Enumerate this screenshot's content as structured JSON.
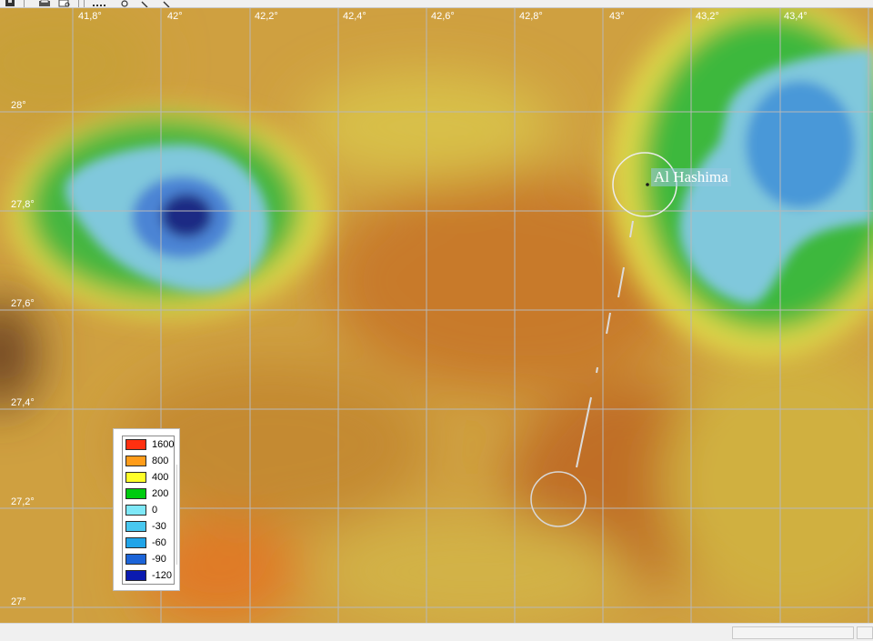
{
  "toolbar": {
    "buttons": [
      {
        "name": "save-icon"
      },
      {
        "name": "print-icon"
      },
      {
        "name": "print-preview-icon"
      },
      {
        "name": "grid-icon"
      },
      {
        "name": "settings-icon"
      },
      {
        "name": "zoom-icon"
      },
      {
        "name": "search-icon"
      }
    ]
  },
  "map": {
    "longitude_labels": [
      "41,8°",
      "42°",
      "42,2°",
      "42,4°",
      "42,6°",
      "42,8°",
      "43°",
      "43,2°",
      "43,4°"
    ],
    "latitude_labels": [
      "28°",
      "27,8°",
      "27,6°",
      "27,4°",
      "27,2°",
      "27°"
    ],
    "place": {
      "name": "Al Hashima"
    }
  },
  "legend": {
    "entries": [
      {
        "value": "1600",
        "color": "#ff3010"
      },
      {
        "value": "800",
        "color": "#ff9c1a"
      },
      {
        "value": "400",
        "color": "#ffff28"
      },
      {
        "value": "200",
        "color": "#00cc10"
      },
      {
        "value": "0",
        "color": "#7ee8f8"
      },
      {
        "value": "-30",
        "color": "#48c8f0"
      },
      {
        "value": "-60",
        "color": "#20a4e8"
      },
      {
        "value": "-90",
        "color": "#1c64d8"
      },
      {
        "value": "-120",
        "color": "#0a1ab0"
      }
    ]
  },
  "colors": {
    "terrain_base": "#cfa040",
    "terrain_dark": "#c07028",
    "terrain_light": "#dcc048",
    "lowland_green": "#3cb83c",
    "water_light": "#80c8dc",
    "water_mid": "#4898d8",
    "water_deep": "#1e2a84",
    "grid_line": "#b8b8b8",
    "track_line": "#dcdcdc"
  }
}
